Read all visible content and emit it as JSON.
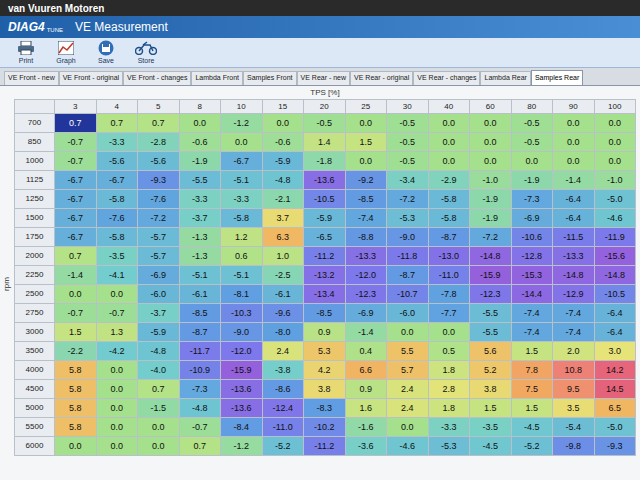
{
  "photo_label": "van Vuuren Motoren",
  "app": {
    "logo": "DIAG4",
    "logo_sub": "TUNE",
    "title": "VE Measurement"
  },
  "toolbar": [
    {
      "label": "Print"
    },
    {
      "label": "Graph"
    },
    {
      "label": "Save"
    },
    {
      "label": "Store"
    }
  ],
  "tabs": [
    {
      "label": "VE Front - new",
      "selected": false
    },
    {
      "label": "VE Front - original",
      "selected": false
    },
    {
      "label": "VE Front - changes",
      "selected": false
    },
    {
      "label": "Lambda Front",
      "selected": false
    },
    {
      "label": "Samples Front",
      "selected": false
    },
    {
      "label": "VE Rear - new",
      "selected": false
    },
    {
      "label": "VE Rear - original",
      "selected": false
    },
    {
      "label": "VE Rear - changes",
      "selected": false
    },
    {
      "label": "Lambda Rear",
      "selected": false
    },
    {
      "label": "Samples Rear",
      "selected": true
    }
  ],
  "table": {
    "x_axis": "TPS [%]",
    "y_axis": "rpm",
    "columns": [
      "3",
      "4",
      "5",
      "8",
      "10",
      "15",
      "20",
      "25",
      "30",
      "40",
      "60",
      "80",
      "90",
      "100"
    ],
    "rows": [
      {
        "rpm": "700",
        "cells": [
          "0.7",
          "0.7",
          "0.7",
          "0.0",
          "-1.2",
          "0.0",
          "-0.5",
          "0.0",
          "-0.5",
          "0.0",
          "0.0",
          "-0.5",
          "0.0",
          "0.0"
        ],
        "selected": [
          true,
          false,
          false,
          false,
          false,
          false,
          false,
          false,
          false,
          false,
          false,
          false,
          false,
          false
        ]
      },
      {
        "rpm": "850",
        "cells": [
          "-0.7",
          "-3.3",
          "-2.8",
          "-0.6",
          "0.0",
          "-0.6",
          "1.4",
          "1.5",
          "-0.5",
          "0.0",
          "0.0",
          "-0.5",
          "0.0",
          "0.0"
        ],
        "selected": [
          false,
          false,
          false,
          false,
          false,
          false,
          false,
          false,
          false,
          false,
          false,
          false,
          false,
          false
        ]
      },
      {
        "rpm": "1000",
        "cells": [
          "-0.7",
          "-5.6",
          "-5.6",
          "-1.9",
          "-6.7",
          "-5.9",
          "-1.8",
          "0.0",
          "-0.5",
          "0.0",
          "0.0",
          "0.0",
          "0.0",
          "0.0"
        ],
        "selected": [
          false,
          false,
          false,
          false,
          false,
          false,
          false,
          false,
          false,
          false,
          false,
          false,
          false,
          false
        ]
      },
      {
        "rpm": "1125",
        "cells": [
          "-6.7",
          "-6.7",
          "-9.3",
          "-5.5",
          "-5.1",
          "-4.8",
          "-13.6",
          "-9.2",
          "-3.4",
          "-2.9",
          "-1.0",
          "-1.9",
          "-1.4",
          "-1.0"
        ],
        "selected": [
          false,
          false,
          false,
          false,
          false,
          false,
          false,
          false,
          false,
          false,
          false,
          false,
          false,
          false
        ]
      },
      {
        "rpm": "1250",
        "cells": [
          "-6.7",
          "-5.8",
          "-7.6",
          "-3.3",
          "-3.3",
          "-2.1",
          "-10.5",
          "-8.5",
          "-7.2",
          "-5.8",
          "-1.9",
          "-7.3",
          "-6.4",
          "-5.0"
        ],
        "selected": [
          false,
          false,
          false,
          false,
          false,
          false,
          false,
          false,
          false,
          false,
          false,
          false,
          false,
          false
        ]
      },
      {
        "rpm": "1500",
        "cells": [
          "-6.7",
          "-7.6",
          "-7.2",
          "-3.7",
          "-5.8",
          "3.7",
          "-5.9",
          "-7.4",
          "-5.3",
          "-5.8",
          "-1.9",
          "-6.9",
          "-6.4",
          "-4.6"
        ],
        "selected": [
          false,
          false,
          false,
          false,
          false,
          false,
          false,
          false,
          false,
          false,
          false,
          false,
          false,
          false
        ]
      },
      {
        "rpm": "1750",
        "cells": [
          "-6.7",
          "-5.8",
          "-5.7",
          "-1.3",
          "1.2",
          "6.3",
          "-6.5",
          "-8.8",
          "-9.0",
          "-8.7",
          "-7.2",
          "-10.6",
          "-11.5",
          "-11.9"
        ],
        "selected": [
          false,
          false,
          false,
          false,
          false,
          false,
          false,
          false,
          false,
          false,
          false,
          false,
          false,
          false
        ]
      },
      {
        "rpm": "2000",
        "cells": [
          "0.7",
          "-3.5",
          "-5.7",
          "-1.3",
          "0.6",
          "1.0",
          "-11.2",
          "-13.3",
          "-11.8",
          "-13.0",
          "-14.8",
          "-12.8",
          "-13.3",
          "-15.6"
        ],
        "selected": [
          false,
          false,
          false,
          false,
          false,
          false,
          false,
          false,
          false,
          false,
          false,
          false,
          false,
          false
        ]
      },
      {
        "rpm": "2250",
        "cells": [
          "-1.4",
          "-4.1",
          "-6.9",
          "-5.1",
          "-5.1",
          "-2.5",
          "-13.2",
          "-12.0",
          "-8.7",
          "-11.0",
          "-15.9",
          "-15.3",
          "-14.8",
          "-14.8"
        ],
        "selected": [
          false,
          false,
          false,
          false,
          false,
          false,
          false,
          false,
          false,
          false,
          false,
          false,
          false,
          false
        ]
      },
      {
        "rpm": "2500",
        "cells": [
          "0.0",
          "0.0",
          "-6.0",
          "-6.1",
          "-8.1",
          "-6.1",
          "-13.4",
          "-12.3",
          "-10.7",
          "-7.8",
          "-12.3",
          "-14.4",
          "-12.9",
          "-10.5"
        ],
        "selected": [
          false,
          false,
          false,
          false,
          false,
          false,
          false,
          false,
          false,
          false,
          false,
          false,
          false,
          false
        ]
      },
      {
        "rpm": "2750",
        "cells": [
          "-0.7",
          "-0.7",
          "-3.7",
          "-8.5",
          "-10.3",
          "-9.6",
          "-8.5",
          "-6.9",
          "-6.0",
          "-7.7",
          "-5.5",
          "-7.4",
          "-7.4",
          "-6.4"
        ],
        "selected": [
          false,
          false,
          false,
          false,
          false,
          false,
          false,
          false,
          false,
          false,
          false,
          false,
          false,
          false
        ]
      },
      {
        "rpm": "3000",
        "cells": [
          "1.5",
          "1.3",
          "-5.9",
          "-8.7",
          "-9.0",
          "-8.0",
          "0.9",
          "-1.4",
          "0.0",
          "0.0",
          "-5.5",
          "-7.4",
          "-7.4",
          "-6.4"
        ],
        "selected": [
          false,
          false,
          false,
          false,
          false,
          false,
          false,
          false,
          false,
          false,
          false,
          false,
          false,
          false
        ]
      },
      {
        "rpm": "3500",
        "cells": [
          "-2.2",
          "-4.2",
          "-4.8",
          "-11.7",
          "-12.0",
          "2.4",
          "5.3",
          "0.4",
          "5.5",
          "0.5",
          "5.6",
          "1.5",
          "2.0",
          "3.0"
        ],
        "selected": [
          false,
          false,
          false,
          false,
          false,
          false,
          false,
          false,
          false,
          false,
          false,
          false,
          false,
          false
        ]
      },
      {
        "rpm": "4000",
        "cells": [
          "5.8",
          "0.0",
          "-4.0",
          "-10.9",
          "-15.9",
          "-3.8",
          "4.2",
          "6.6",
          "5.7",
          "1.8",
          "5.2",
          "7.8",
          "10.8",
          "14.2"
        ],
        "selected": [
          false,
          false,
          false,
          false,
          false,
          false,
          false,
          false,
          false,
          false,
          false,
          false,
          false,
          false
        ]
      },
      {
        "rpm": "4500",
        "cells": [
          "5.8",
          "0.0",
          "0.7",
          "-7.3",
          "-13.6",
          "-8.6",
          "3.8",
          "0.9",
          "2.4",
          "2.8",
          "3.8",
          "7.5",
          "9.5",
          "14.5"
        ],
        "selected": [
          false,
          false,
          false,
          false,
          false,
          false,
          false,
          false,
          false,
          false,
          false,
          false,
          false,
          false
        ]
      },
      {
        "rpm": "5000",
        "cells": [
          "5.8",
          "0.0",
          "-1.5",
          "-4.8",
          "-13.6",
          "-12.4",
          "-8.3",
          "1.6",
          "2.4",
          "1.8",
          "1.5",
          "1.5",
          "3.5",
          "6.5"
        ],
        "selected": [
          false,
          false,
          false,
          false,
          false,
          false,
          false,
          false,
          false,
          false,
          false,
          false,
          false,
          false
        ]
      },
      {
        "rpm": "5500",
        "cells": [
          "5.8",
          "0.0",
          "0.0",
          "-0.7",
          "-8.4",
          "-11.0",
          "-10.2",
          "-1.6",
          "0.0",
          "-3.3",
          "-3.5",
          "-4.5",
          "-5.4",
          "-5.0"
        ],
        "selected": [
          false,
          false,
          false,
          false,
          false,
          false,
          false,
          false,
          false,
          false,
          false,
          false,
          false,
          false
        ]
      },
      {
        "rpm": "6000",
        "cells": [
          "0.0",
          "0.0",
          "0.0",
          "0.7",
          "-1.2",
          "-5.2",
          "-11.2",
          "-3.6",
          "-4.6",
          "-5.3",
          "-4.5",
          "-5.2",
          "-9.8",
          "-9.3"
        ],
        "selected": [
          false,
          false,
          false,
          false,
          false,
          false,
          false,
          false,
          false,
          false,
          false,
          false,
          false,
          false
        ]
      }
    ]
  }
}
